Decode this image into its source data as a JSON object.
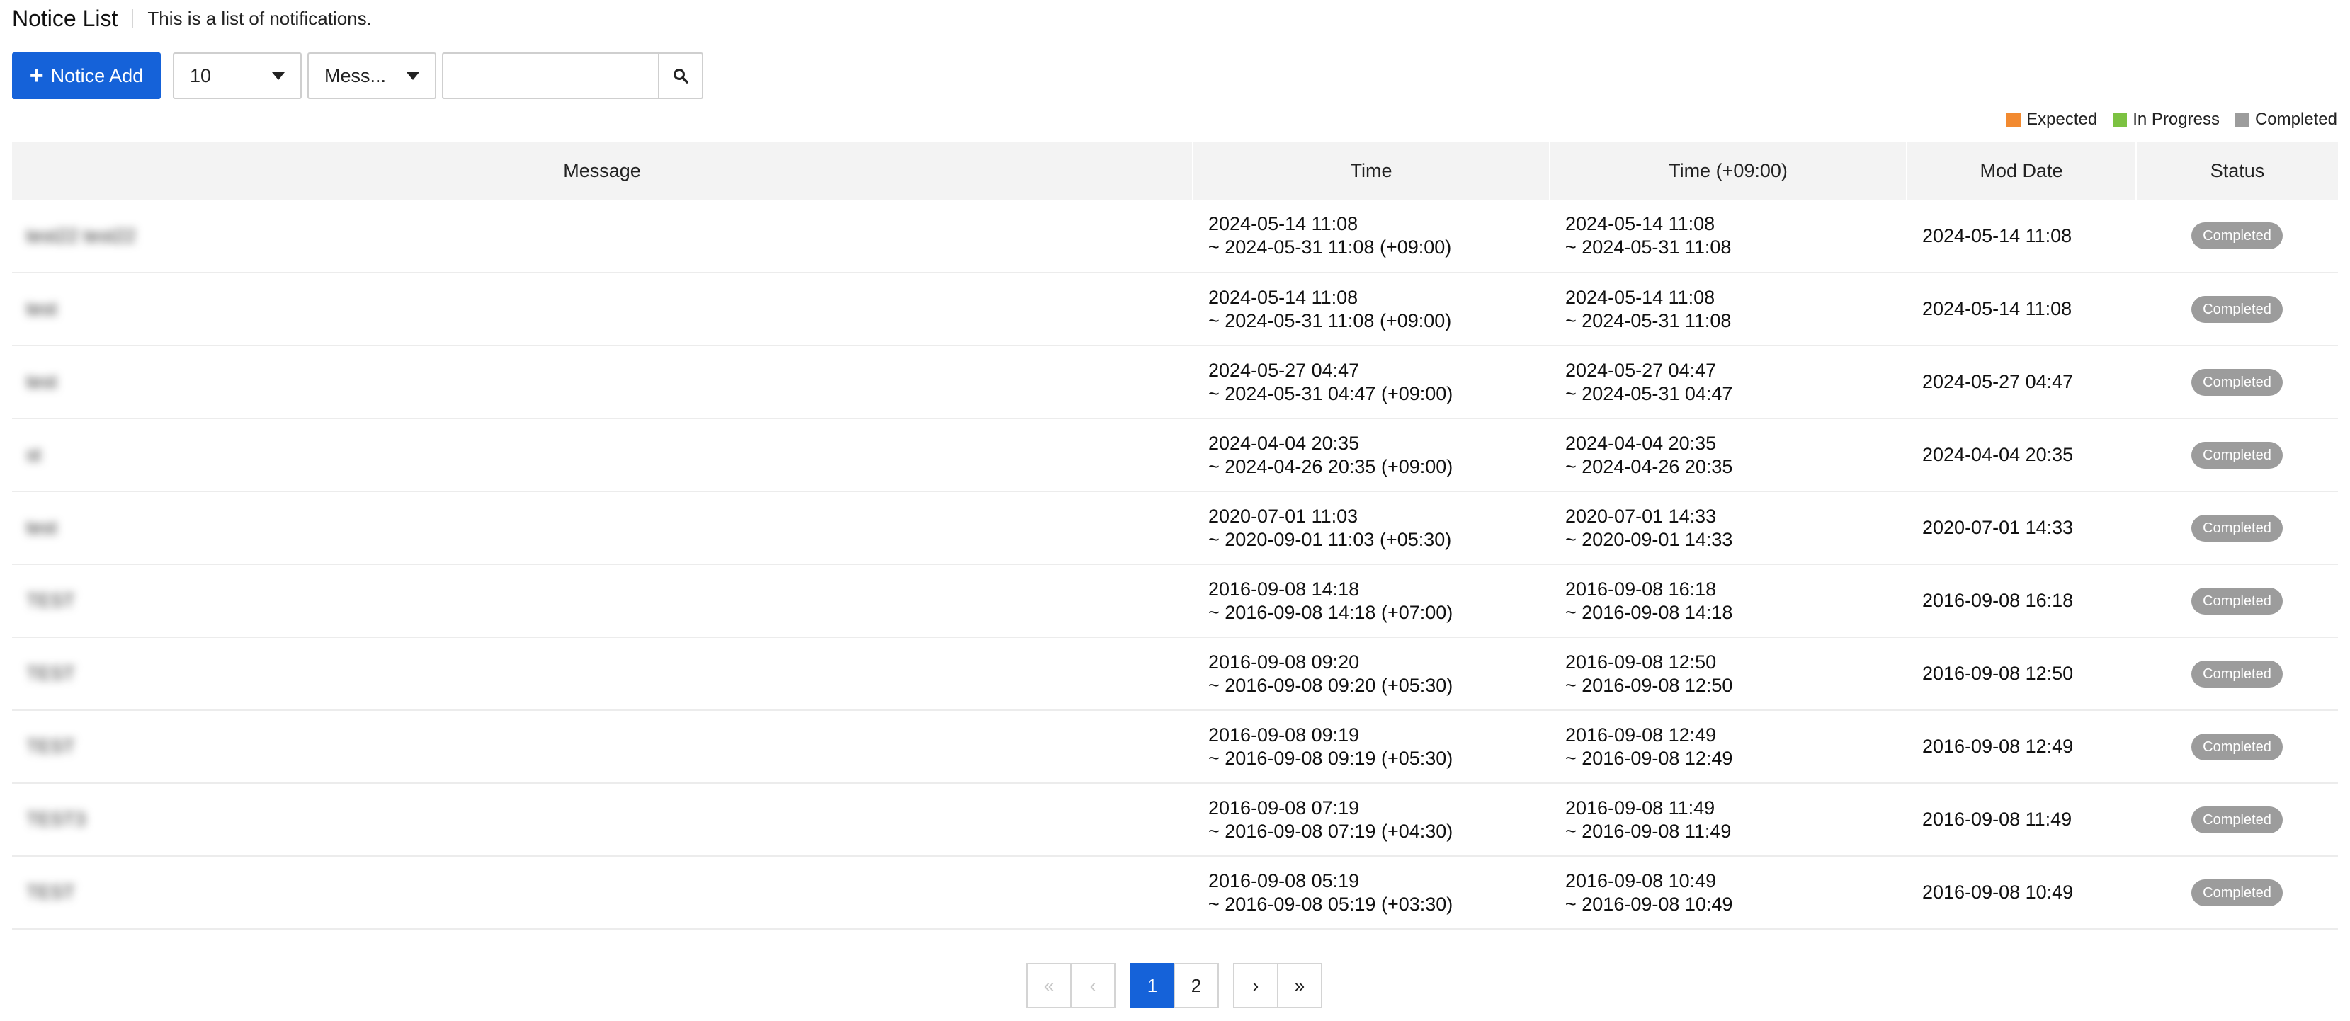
{
  "header": {
    "title": "Notice List",
    "description": "This is a list of notifications."
  },
  "toolbar": {
    "add_label": "Notice Add",
    "page_size": "10",
    "search_field": "Mess...",
    "search_placeholder": ""
  },
  "legend": [
    {
      "label": "Expected",
      "color": "#f28a30"
    },
    {
      "label": "In Progress",
      "color": "#7cc242"
    },
    {
      "label": "Completed",
      "color": "#9c9c9c"
    }
  ],
  "table": {
    "columns": [
      "Message",
      "Time",
      "Time (+09:00)",
      "Mod Date",
      "Status"
    ],
    "rows": [
      {
        "message": "test22 test22",
        "time_start": "2024-05-14 11:08",
        "time_end": "~ 2024-05-31 11:08 (+09:00)",
        "kst_start": "2024-05-14 11:08",
        "kst_end": "~ 2024-05-31 11:08",
        "mod_date": "2024-05-14 11:08",
        "status": "Completed"
      },
      {
        "message": "test",
        "time_start": "2024-05-14 11:08",
        "time_end": "~ 2024-05-31 11:08 (+09:00)",
        "kst_start": "2024-05-14 11:08",
        "kst_end": "~ 2024-05-31 11:08",
        "mod_date": "2024-05-14 11:08",
        "status": "Completed"
      },
      {
        "message": "test",
        "time_start": "2024-05-27 04:47",
        "time_end": "~ 2024-05-31 04:47 (+09:00)",
        "kst_start": "2024-05-27 04:47",
        "kst_end": "~ 2024-05-31 04:47",
        "mod_date": "2024-05-27 04:47",
        "status": "Completed"
      },
      {
        "message": "st",
        "time_start": "2024-04-04 20:35",
        "time_end": "~ 2024-04-26 20:35 (+09:00)",
        "kst_start": "2024-04-04 20:35",
        "kst_end": "~ 2024-04-26 20:35",
        "mod_date": "2024-04-04 20:35",
        "status": "Completed"
      },
      {
        "message": "test",
        "time_start": "2020-07-01 11:03",
        "time_end": "~ 2020-09-01 11:03 (+05:30)",
        "kst_start": "2020-07-01 14:33",
        "kst_end": "~ 2020-09-01 14:33",
        "mod_date": "2020-07-01 14:33",
        "status": "Completed"
      },
      {
        "message": "TEST",
        "time_start": "2016-09-08 14:18",
        "time_end": "~ 2016-09-08 14:18 (+07:00)",
        "kst_start": "2016-09-08 16:18",
        "kst_end": "~ 2016-09-08 14:18",
        "mod_date": "2016-09-08 16:18",
        "status": "Completed"
      },
      {
        "message": "TEST",
        "time_start": "2016-09-08 09:20",
        "time_end": "~ 2016-09-08 09:20 (+05:30)",
        "kst_start": "2016-09-08 12:50",
        "kst_end": "~ 2016-09-08 12:50",
        "mod_date": "2016-09-08 12:50",
        "status": "Completed"
      },
      {
        "message": "TEST",
        "time_start": "2016-09-08 09:19",
        "time_end": "~ 2016-09-08 09:19 (+05:30)",
        "kst_start": "2016-09-08 12:49",
        "kst_end": "~ 2016-09-08 12:49",
        "mod_date": "2016-09-08 12:49",
        "status": "Completed"
      },
      {
        "message": "TEST3",
        "time_start": "2016-09-08 07:19",
        "time_end": "~ 2016-09-08 07:19 (+04:30)",
        "kst_start": "2016-09-08 11:49",
        "kst_end": "~ 2016-09-08 11:49",
        "mod_date": "2016-09-08 11:49",
        "status": "Completed"
      },
      {
        "message": "TEST",
        "time_start": "2016-09-08 05:19",
        "time_end": "~ 2016-09-08 05:19 (+03:30)",
        "kst_start": "2016-09-08 10:49",
        "kst_end": "~ 2016-09-08 10:49",
        "mod_date": "2016-09-08 10:49",
        "status": "Completed"
      }
    ]
  },
  "pagination": {
    "first": "«",
    "prev": "‹",
    "pages": [
      "1",
      "2"
    ],
    "current": "1",
    "next": "›",
    "last": "»"
  }
}
